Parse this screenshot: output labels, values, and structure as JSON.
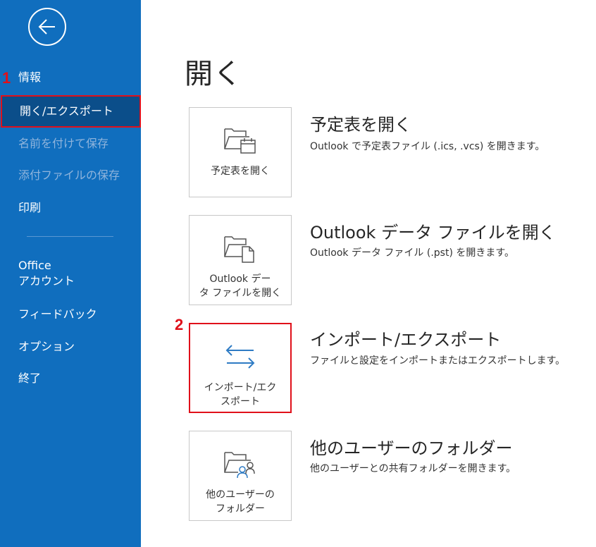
{
  "sidebar": {
    "items": [
      {
        "label": "情報"
      },
      {
        "label": "開く/エクスポート"
      },
      {
        "label": "名前を付けて保存"
      },
      {
        "label": "添付ファイルの保存"
      },
      {
        "label": "印刷"
      },
      {
        "label": "Office"
      },
      {
        "label": "アカウント"
      },
      {
        "label": "フィードバック"
      },
      {
        "label": "オプション"
      },
      {
        "label": "終了"
      }
    ]
  },
  "annotations": {
    "step1": "1",
    "step2": "2"
  },
  "main": {
    "title": "開く",
    "options": [
      {
        "tile_label": "予定表を開く",
        "title": "予定表を開く",
        "description": "Outlook で予定表ファイル (.ics, .vcs) を開きます。",
        "icon": "calendar-folder-icon"
      },
      {
        "tile_label_1": "Outlook デー",
        "tile_label_2": "タ ファイルを開く",
        "title": "Outlook データ ファイルを開く",
        "description": "Outlook データ ファイル (.pst) を開きます。",
        "icon": "data-file-folder-icon"
      },
      {
        "tile_label_1": "インポート/エク",
        "tile_label_2": "スポート",
        "title": "インポート/エクスポート",
        "description": "ファイルと設定をインポートまたはエクスポートします。",
        "icon": "import-export-arrows-icon"
      },
      {
        "tile_label_1": "他のユーザーの",
        "tile_label_2": "フォルダー",
        "title": "他のユーザーのフォルダー",
        "description": "他のユーザーとの共有フォルダーを開きます。",
        "icon": "shared-folder-icon"
      }
    ]
  },
  "colors": {
    "sidebar": "#106ebe",
    "selected": "#0b4e8a",
    "highlight": "#e0101a",
    "accent_icon": "#2e7bc4"
  }
}
